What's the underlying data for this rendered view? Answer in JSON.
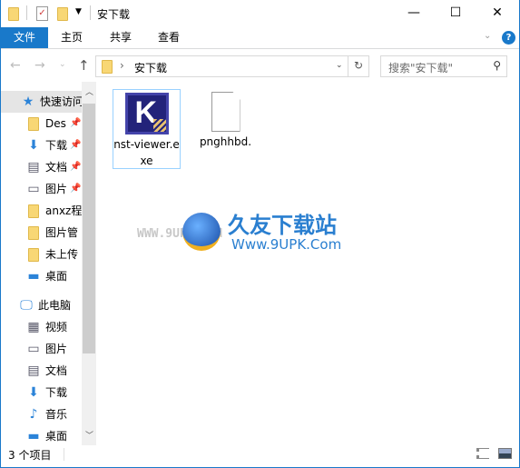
{
  "window": {
    "title": "安下载",
    "minimize": "—",
    "maximize": "☐",
    "close": "✕"
  },
  "ribbon": {
    "tabs": [
      "文件",
      "主页",
      "共享",
      "查看"
    ],
    "help": "?"
  },
  "address": {
    "path": "安下载",
    "search_placeholder": "搜索\"安下载\""
  },
  "nav": {
    "quick_access": "快速访问",
    "quick_items": [
      {
        "label": "Des",
        "icon": "folder-icon"
      },
      {
        "label": "下载",
        "icon": "download-icon"
      },
      {
        "label": "文档",
        "icon": "document-icon"
      },
      {
        "label": "图片",
        "icon": "picture-icon"
      },
      {
        "label": "anxz程",
        "icon": "folder-icon"
      },
      {
        "label": "图片管",
        "icon": "folder-icon"
      },
      {
        "label": "未上传",
        "icon": "folder-icon"
      },
      {
        "label": "桌面",
        "icon": "desktop-icon"
      }
    ],
    "this_pc": "此电脑",
    "pc_items": [
      {
        "label": "视频",
        "icon": "video-icon"
      },
      {
        "label": "图片",
        "icon": "picture-icon"
      },
      {
        "label": "文档",
        "icon": "document-icon"
      },
      {
        "label": "下载",
        "icon": "download-icon"
      },
      {
        "label": "音乐",
        "icon": "music-icon"
      },
      {
        "label": "桌面",
        "icon": "desktop-icon"
      }
    ]
  },
  "files": [
    {
      "name": "nst-viewer.exe",
      "icon": "app-k-icon"
    },
    {
      "name": "pnghhbd.",
      "icon": "blank-file-icon"
    }
  ],
  "watermark": {
    "brand": "久友下载站",
    "url": "Www.9UPK.Com",
    "url2": "WWW.9UPK.COM"
  },
  "status": {
    "count": "3 个项目"
  },
  "colors": {
    "accent": "#1979ca",
    "selection": "#99d1ff"
  }
}
